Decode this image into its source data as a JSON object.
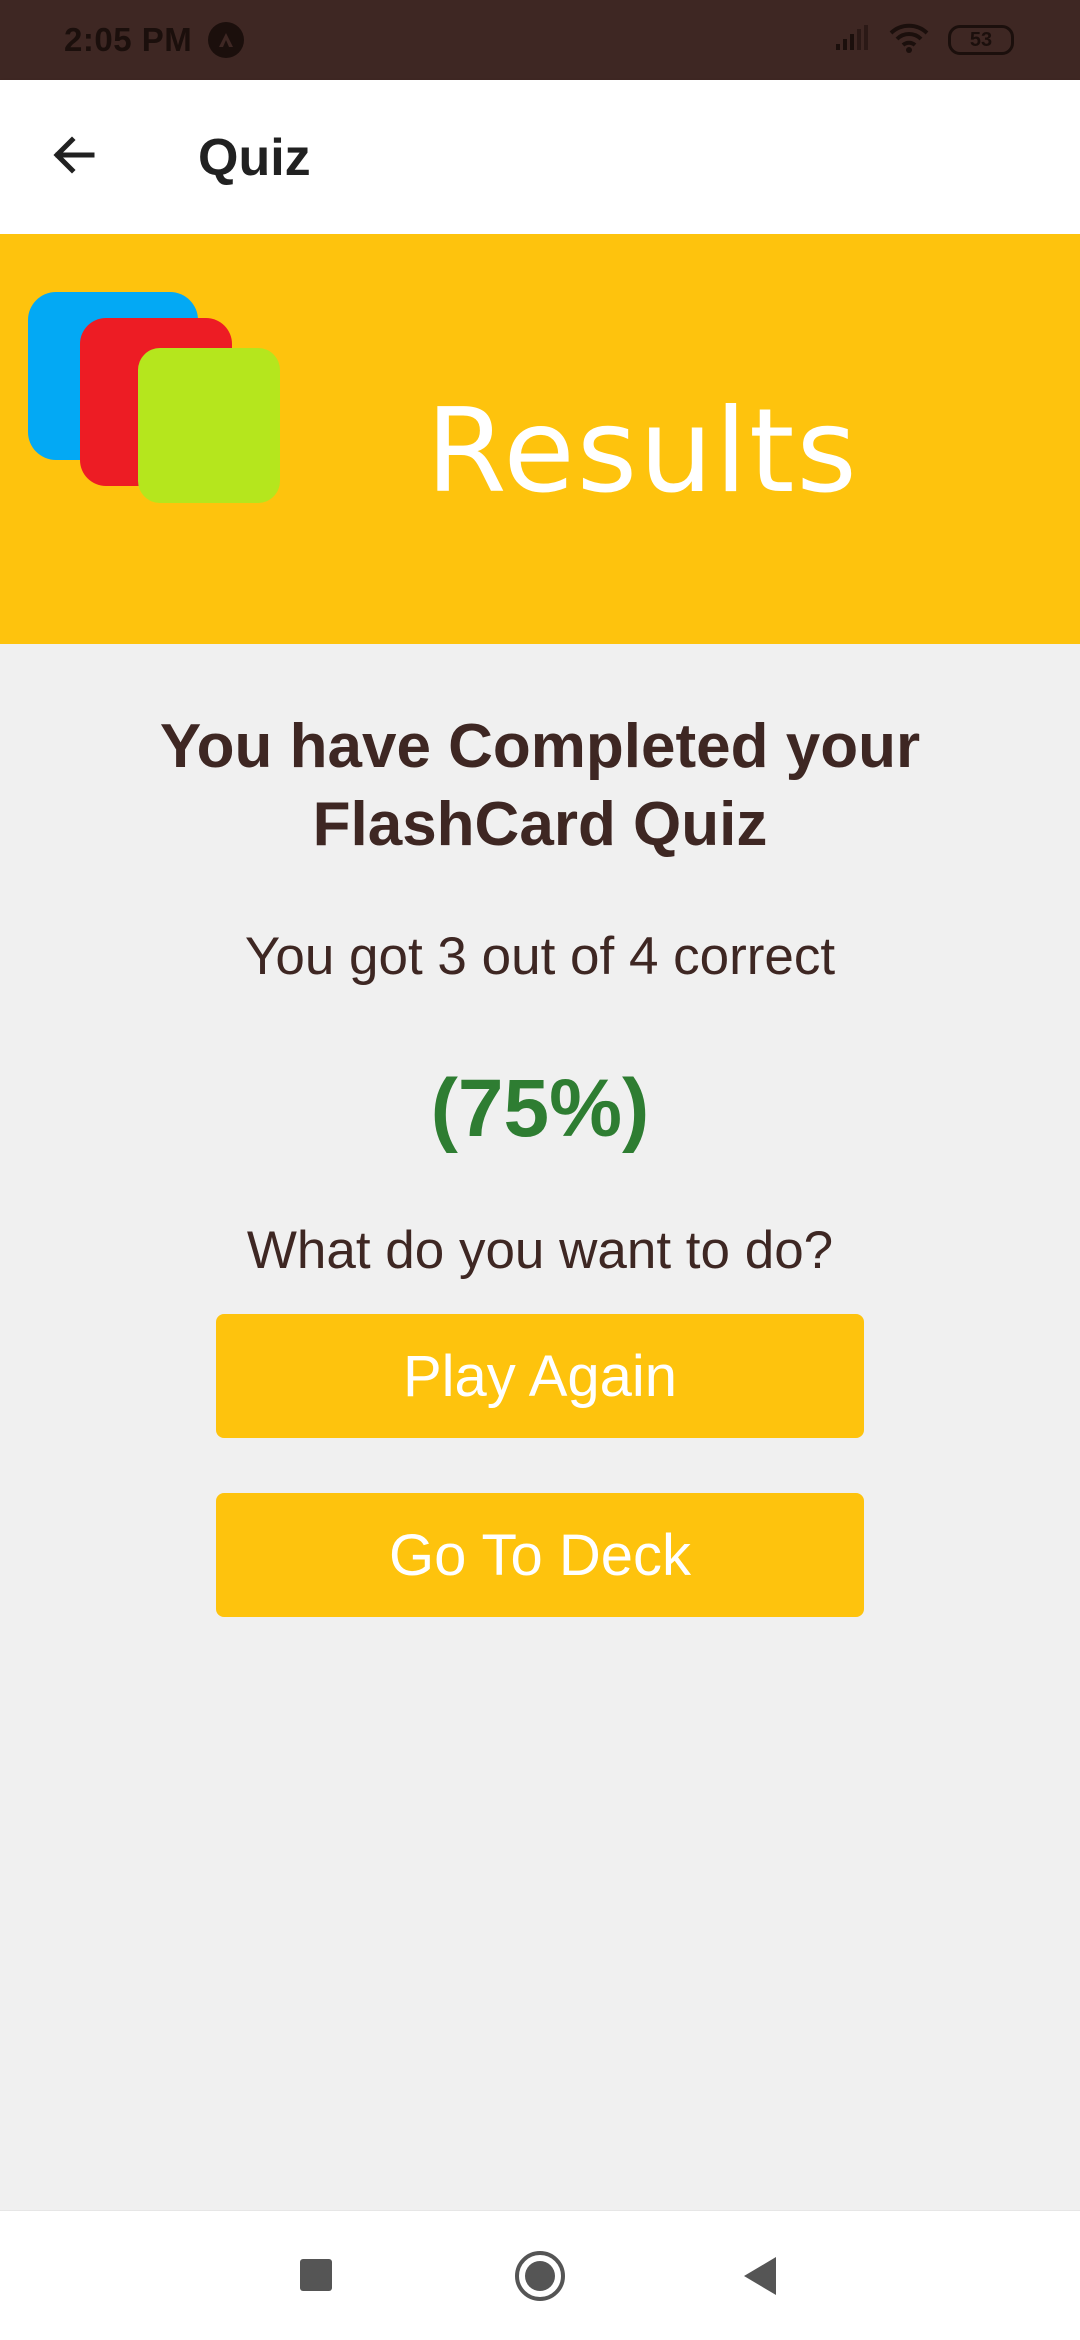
{
  "status_bar": {
    "time": "2:05 PM",
    "battery": "53",
    "icons": [
      "app-notification-icon",
      "signal-icon",
      "wifi-icon",
      "battery-icon"
    ]
  },
  "app_bar": {
    "title": "Quiz",
    "back_icon": "arrow-left-icon"
  },
  "banner": {
    "title": "Results",
    "card_colors": [
      "#03a9f4",
      "#ed1c24",
      "#b5e61d"
    ],
    "background": "#fec30d"
  },
  "results": {
    "heading": "You have Completed your FlashCard Quiz",
    "score": "You got 3 out of 4 correct",
    "percent": "(75%)",
    "prompt": "What do you want to do?"
  },
  "actions": {
    "play_again": "Play Again",
    "go_to_deck": "Go To Deck"
  },
  "nav_bar": {
    "icons": [
      "recents-square-icon",
      "home-circle-icon",
      "back-triangle-icon"
    ]
  },
  "colors": {
    "accent": "#fec30d",
    "text_primary": "#3e2723",
    "success": "#2e7d32",
    "status_bar": "#3e2723"
  }
}
